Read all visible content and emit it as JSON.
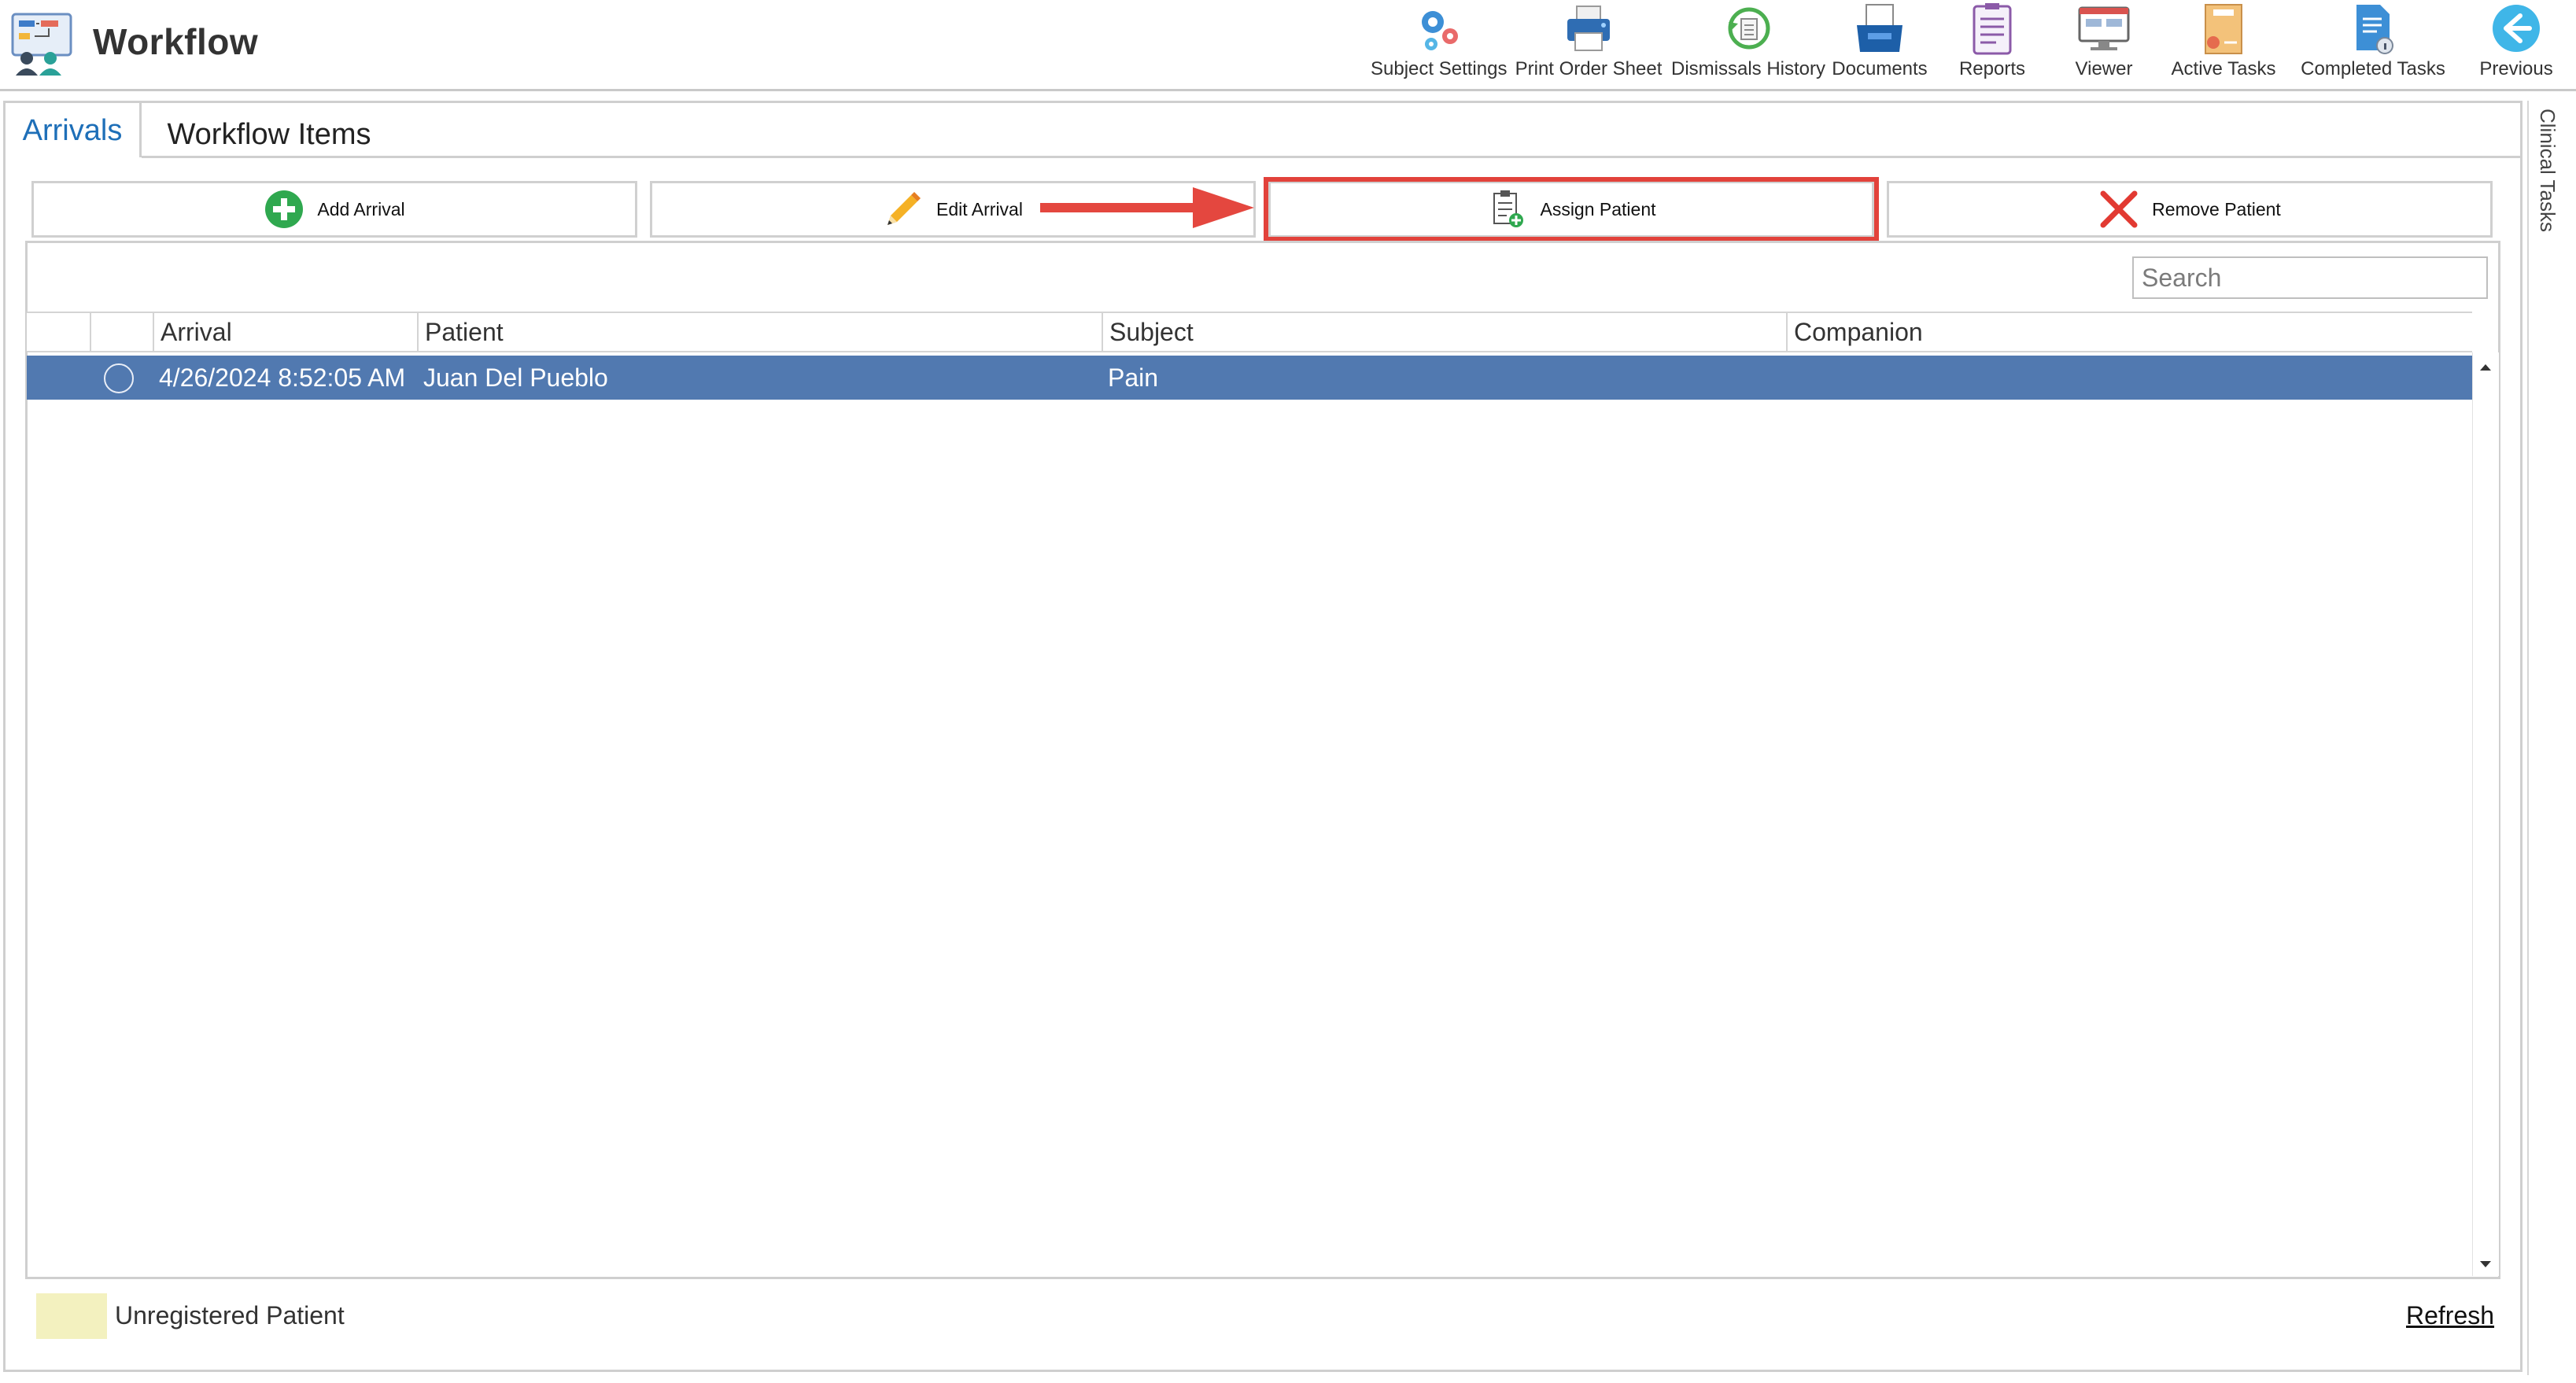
{
  "app": {
    "title": "Workflow"
  },
  "toolbar": [
    {
      "label": "Subject Settings",
      "icon": "gears-icon"
    },
    {
      "label": "Print Order Sheet",
      "icon": "printer-icon"
    },
    {
      "label": "Dismissals History",
      "icon": "history-icon"
    },
    {
      "label": "Documents",
      "icon": "document-tray-icon"
    },
    {
      "label": "Reports",
      "icon": "clipboard-list-icon"
    },
    {
      "label": "Viewer",
      "icon": "monitor-icon"
    },
    {
      "label": "Active Tasks",
      "icon": "folder-tasks-icon"
    },
    {
      "label": "Completed Tasks",
      "icon": "document-info-icon"
    },
    {
      "label": "Previous",
      "icon": "arrow-left-circle-icon"
    }
  ],
  "sidebar": {
    "label": "Clinical Tasks"
  },
  "tabs": [
    {
      "label": "Arrivals",
      "active": true
    },
    {
      "label": "Workflow Items",
      "active": false
    }
  ],
  "actions": {
    "add_arrival": "Add Arrival",
    "edit_arrival": "Edit Arrival",
    "assign_patient": "Assign Patient",
    "remove_patient": "Remove Patient"
  },
  "search": {
    "placeholder": "Search",
    "value": ""
  },
  "grid": {
    "columns": [
      "Arrival",
      "Patient",
      "Subject",
      "Companion"
    ],
    "rows": [
      {
        "arrival": "4/26/2024 8:52:05 AM",
        "patient": "Juan Del Pueblo",
        "subject": "Pain",
        "companion": "",
        "selected": true
      }
    ]
  },
  "legend": {
    "label": "Unregistered Patient",
    "color": "#f3f1bf"
  },
  "footer": {
    "refresh_label": "Refresh"
  },
  "colors": {
    "accent": "#1e6fb8",
    "selected_row": "#5179b0",
    "highlight": "#e2423b"
  }
}
